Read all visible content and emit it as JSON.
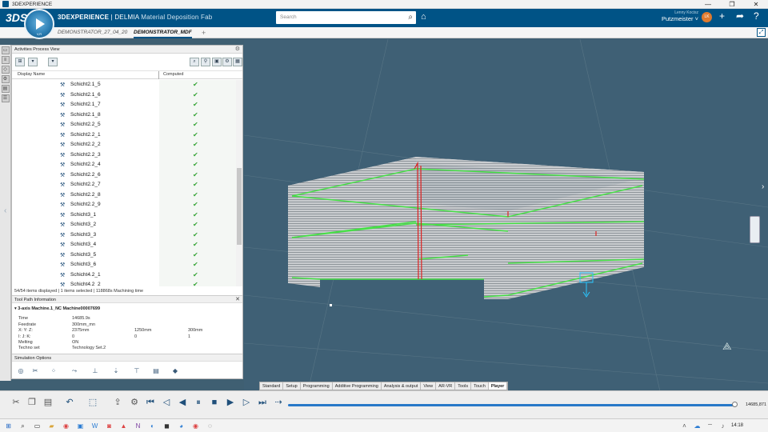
{
  "window": {
    "title": "3DEXPERIENCE",
    "minimize": "—",
    "restore": "❐",
    "close": "✕"
  },
  "header": {
    "brand_left": "3DEXPERIENCE",
    "brand_sep": " | DELMIA ",
    "app_name": "Material Deposition Fab",
    "compass_caption": "V,R",
    "search_placeholder": "Search",
    "user_name": "Lenny Kocisz",
    "tenant": "Putzmeister ˅",
    "avatar_initials": "LK",
    "colors": {
      "bar": "#005386",
      "accent": "#e07a2e"
    }
  },
  "tabs": [
    {
      "label": "DEMONSTRATOR_27_04_20",
      "active": false
    },
    {
      "label": "DEMONSTRATOR_MDF",
      "active": true
    }
  ],
  "tab_add": "+",
  "panel": {
    "title": "Activities Process View",
    "col_display_name": "Display Name",
    "col_computed": "Computed",
    "rows": [
      "Schicht2.1_5",
      "Schicht2.1_6",
      "Schicht2.1_7",
      "Schicht2.1_8",
      "Schicht2.2_5",
      "Schicht2.2_1",
      "Schicht2.2_2",
      "Schicht2.2_3",
      "Schicht2.2_4",
      "Schicht2.2_6",
      "Schicht2.2_7",
      "Schicht2.2_8",
      "Schicht2.2_9",
      "Schicht3_1",
      "Schicht3_2",
      "Schicht3_3",
      "Schicht3_4",
      "Schicht3_5",
      "Schicht3_6",
      "Schicht4.2_1",
      "Schicht4.2_2"
    ],
    "status": "54/54 items displayed | 1 items selected | 118868s Machining time"
  },
  "toolpath": {
    "title": "Tool Path Information",
    "machine": "▾ 3-axis Machine.1_NC Machine00007699",
    "time_label": "Time",
    "time_value": "14685.9s",
    "feedrate_label": "Feedrate",
    "feedrate_value": "300mm_mn",
    "xyz_label": "X: Y: Z:",
    "x": "2375mm",
    "y": "1250mm",
    "z": "300mm",
    "ijk_label": "I: J: K:",
    "i": "0",
    "j": "0",
    "k": "1",
    "melting_label": "Melting",
    "melting_value": "ON",
    "techno_label": "Techno set",
    "techno_value": "Technology Set.2"
  },
  "simulation": {
    "title": "Simulation Options"
  },
  "section_tabs": [
    "Standard",
    "Setup",
    "Programming",
    "Additive Programming",
    "Analysis & output",
    "View",
    "AR-VR",
    "Tools",
    "Touch",
    "Player"
  ],
  "player": {
    "progress": 0.99,
    "time_value": "14685,871"
  },
  "taskbar": {
    "time": "14:18"
  }
}
